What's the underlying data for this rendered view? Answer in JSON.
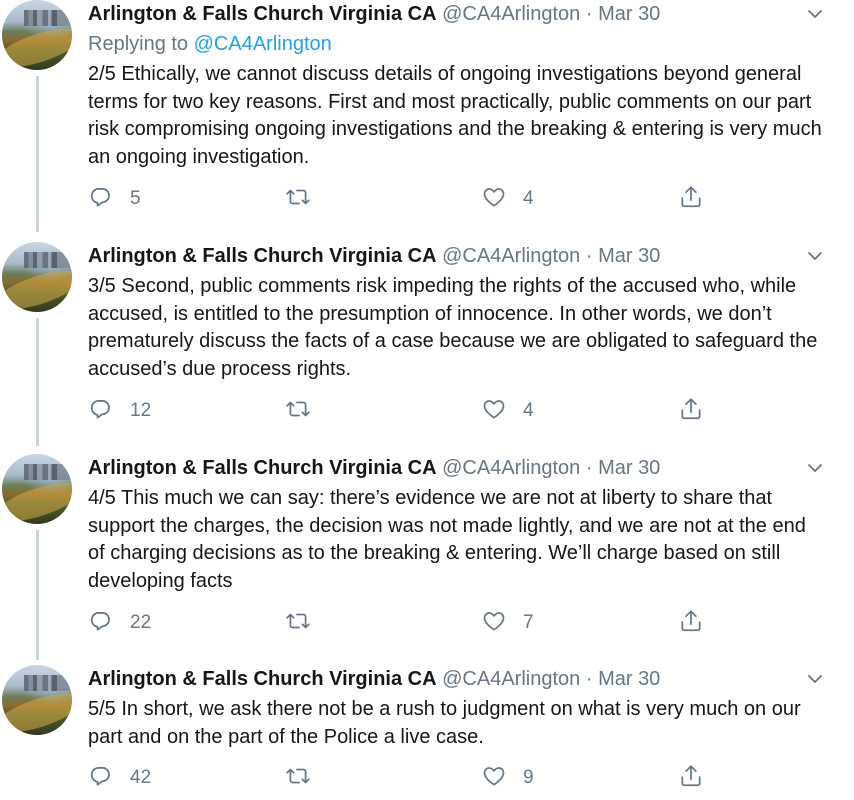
{
  "author": {
    "name": "Arlington & Falls Church Virginia CA",
    "handle": "@CA4Arlington",
    "separator": "·"
  },
  "icons": {
    "reply": "reply-icon",
    "retweet": "retweet-icon",
    "like": "heart-icon",
    "share": "share-icon",
    "menu": "chevron-down-icon"
  },
  "colors": {
    "text": "#14171a",
    "secondary": "#657786",
    "link": "#1da1f2",
    "thread_line": "#ccd6dd"
  },
  "tweets": [
    {
      "date": "Mar 30",
      "replying_prefix": "Replying to",
      "replying_to": "@CA4Arlington",
      "text": "2/5 Ethically, we cannot discuss details of ongoing investigations beyond general terms for two key reasons. First and most practically, public comments on our part risk compromising ongoing investigations and the breaking & entering is very much an ongoing investigation.",
      "replies": "5",
      "retweets": "",
      "likes": "4"
    },
    {
      "date": "Mar 30",
      "text": "3/5 Second, public comments risk impeding the rights of the accused who, while accused, is entitled to the presumption of innocence. In other words, we don’t prematurely discuss the facts of a case because we are obligated to safeguard the accused’s due process rights.",
      "replies": "12",
      "retweets": "",
      "likes": "4"
    },
    {
      "date": "Mar 30",
      "text": "4/5 This much we can say: there’s evidence we are not at liberty to share that support the charges, the decision was not made lightly, and we are not at the end of charging decisions as to the breaking & entering. We’ll charge based on still developing facts",
      "replies": "22",
      "retweets": "",
      "likes": "7"
    },
    {
      "date": "Mar 30",
      "text": "5/5 In short, we ask there not be a rush to judgment on what is very much on our part and on the part of the Police a live case.",
      "replies": "42",
      "retweets": "",
      "likes": "9"
    }
  ]
}
